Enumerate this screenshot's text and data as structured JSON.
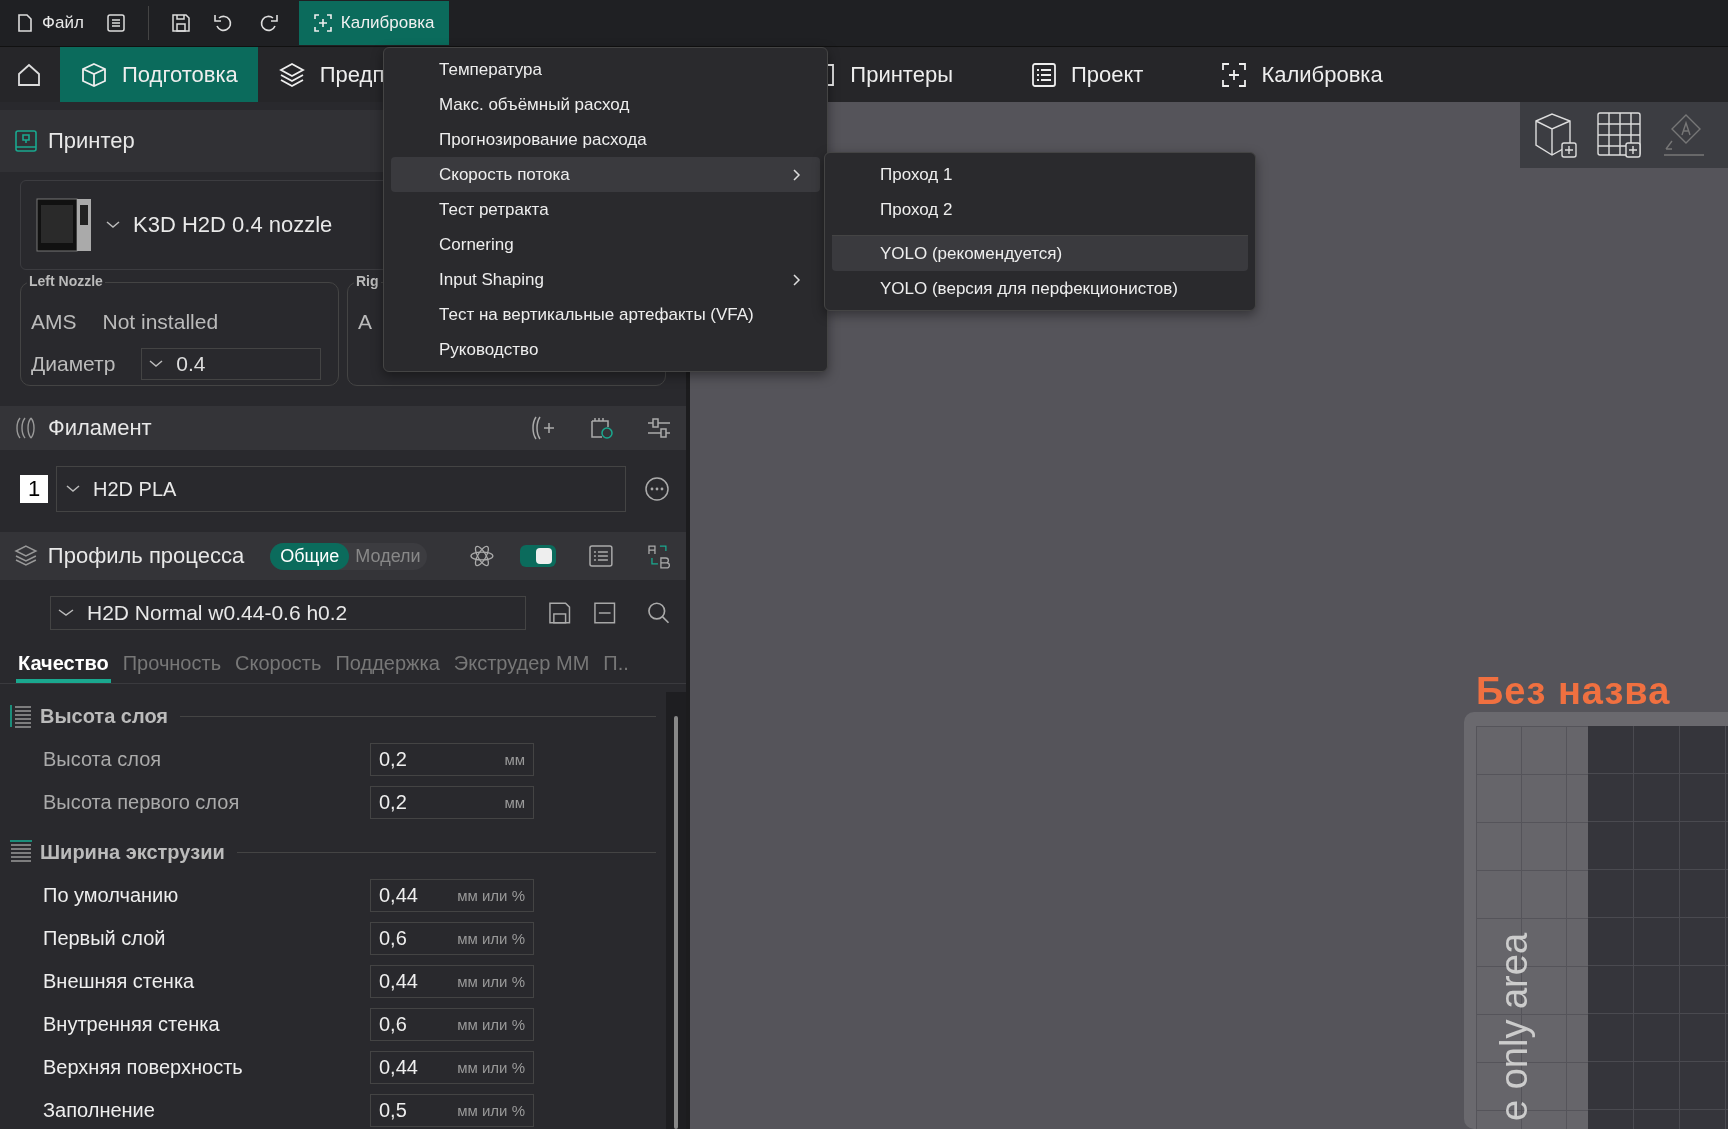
{
  "toolbar": {
    "file_label": "Файл",
    "calibration_button": {
      "label": "Калибровка",
      "selected": true
    }
  },
  "tabs": [
    {
      "label": "Подготовка",
      "selected": true,
      "kind": "prepare"
    },
    {
      "label": "Предп",
      "selected": false,
      "kind": "preview"
    },
    {
      "label": "Принтеры",
      "selected": false,
      "kind": "device"
    },
    {
      "label": "Проект",
      "selected": false,
      "kind": "project"
    },
    {
      "label": "Калибровка",
      "selected": false,
      "kind": "calibration"
    }
  ],
  "printer": {
    "title": "Принтер",
    "name": "K3D H2D 0.4 nozzle",
    "nozzles": [
      {
        "title": "Left Nozzle",
        "ams_label": "AMS",
        "ams_value": "Not installed",
        "diameter_label": "Диаметр",
        "diameter": "0.4"
      },
      {
        "title": "Rig",
        "ams_label": "A"
      }
    ]
  },
  "filament": {
    "title": "Филамент",
    "items": [
      {
        "index": "1",
        "name": "H2D PLA"
      }
    ]
  },
  "process": {
    "title": "Профиль процесса",
    "modes": [
      {
        "label": "Общие",
        "selected": true
      },
      {
        "label": "Модели",
        "selected": false
      }
    ],
    "advanced_on": true,
    "preset": "H2D Normal w0.44-0.6 h0.2",
    "tabs": [
      {
        "label": "Качество",
        "selected": true
      },
      {
        "label": "Прочность",
        "selected": false
      },
      {
        "label": "Скорость",
        "selected": false
      },
      {
        "label": "Поддержка",
        "selected": false
      },
      {
        "label": "Экструдер ММ",
        "selected": false
      },
      {
        "label": "П..",
        "selected": false
      }
    ],
    "groups": [
      {
        "title": "Высота слоя",
        "kind": "height",
        "options": [
          {
            "label": "Высота слоя",
            "value": "0,2",
            "unit": "мм",
            "muted": true
          },
          {
            "label": "Высота первого слоя",
            "value": "0,2",
            "unit": "мм",
            "muted": true
          }
        ]
      },
      {
        "title": "Ширина экструзии",
        "kind": "width",
        "options": [
          {
            "label": "По умолчанию",
            "value": "0,44",
            "unit": "мм или %",
            "muted": false
          },
          {
            "label": "Первый слой",
            "value": "0,6",
            "unit": "мм или %",
            "muted": false
          },
          {
            "label": "Внешняя стенка",
            "value": "0,44",
            "unit": "мм или %",
            "muted": false
          },
          {
            "label": "Внутренняя стенка",
            "value": "0,6",
            "unit": "мм или %",
            "muted": false
          },
          {
            "label": "Верхняя поверхность",
            "value": "0,44",
            "unit": "мм или %",
            "muted": false
          },
          {
            "label": "Заполнение",
            "value": "0,5",
            "unit": "мм или %",
            "muted": false
          }
        ]
      }
    ]
  },
  "viewport": {
    "plate_title": "Без назва",
    "plate_label": "e only area"
  },
  "menu": {
    "items": [
      {
        "label": "Температура",
        "selected": false,
        "submenu": false
      },
      {
        "label": "Макс. объёмный расход",
        "selected": false,
        "submenu": false
      },
      {
        "label": "Прогнозирование расхода",
        "selected": false,
        "submenu": false
      },
      {
        "label": "Скорость потока",
        "selected": true,
        "submenu": true
      },
      {
        "label": "Тест ретракта",
        "selected": false,
        "submenu": false
      },
      {
        "label": "Cornering",
        "selected": false,
        "submenu": false
      },
      {
        "label": "Input Shaping",
        "selected": false,
        "submenu": true
      },
      {
        "label": "Тест на вертикальные артефакты (VFA)",
        "selected": false,
        "submenu": false
      },
      {
        "label": "Руководство",
        "selected": false,
        "submenu": false
      }
    ],
    "submenu": [
      {
        "label": "Проход 1",
        "selected": false,
        "separator_before": false
      },
      {
        "label": "Проход 2",
        "selected": false,
        "separator_before": false
      },
      {
        "label": "YOLO (рекомендуется)",
        "selected": true,
        "separator_before": true
      },
      {
        "label": "YOLO (версия для перфекционистов)",
        "selected": false,
        "separator_before": false
      }
    ]
  }
}
